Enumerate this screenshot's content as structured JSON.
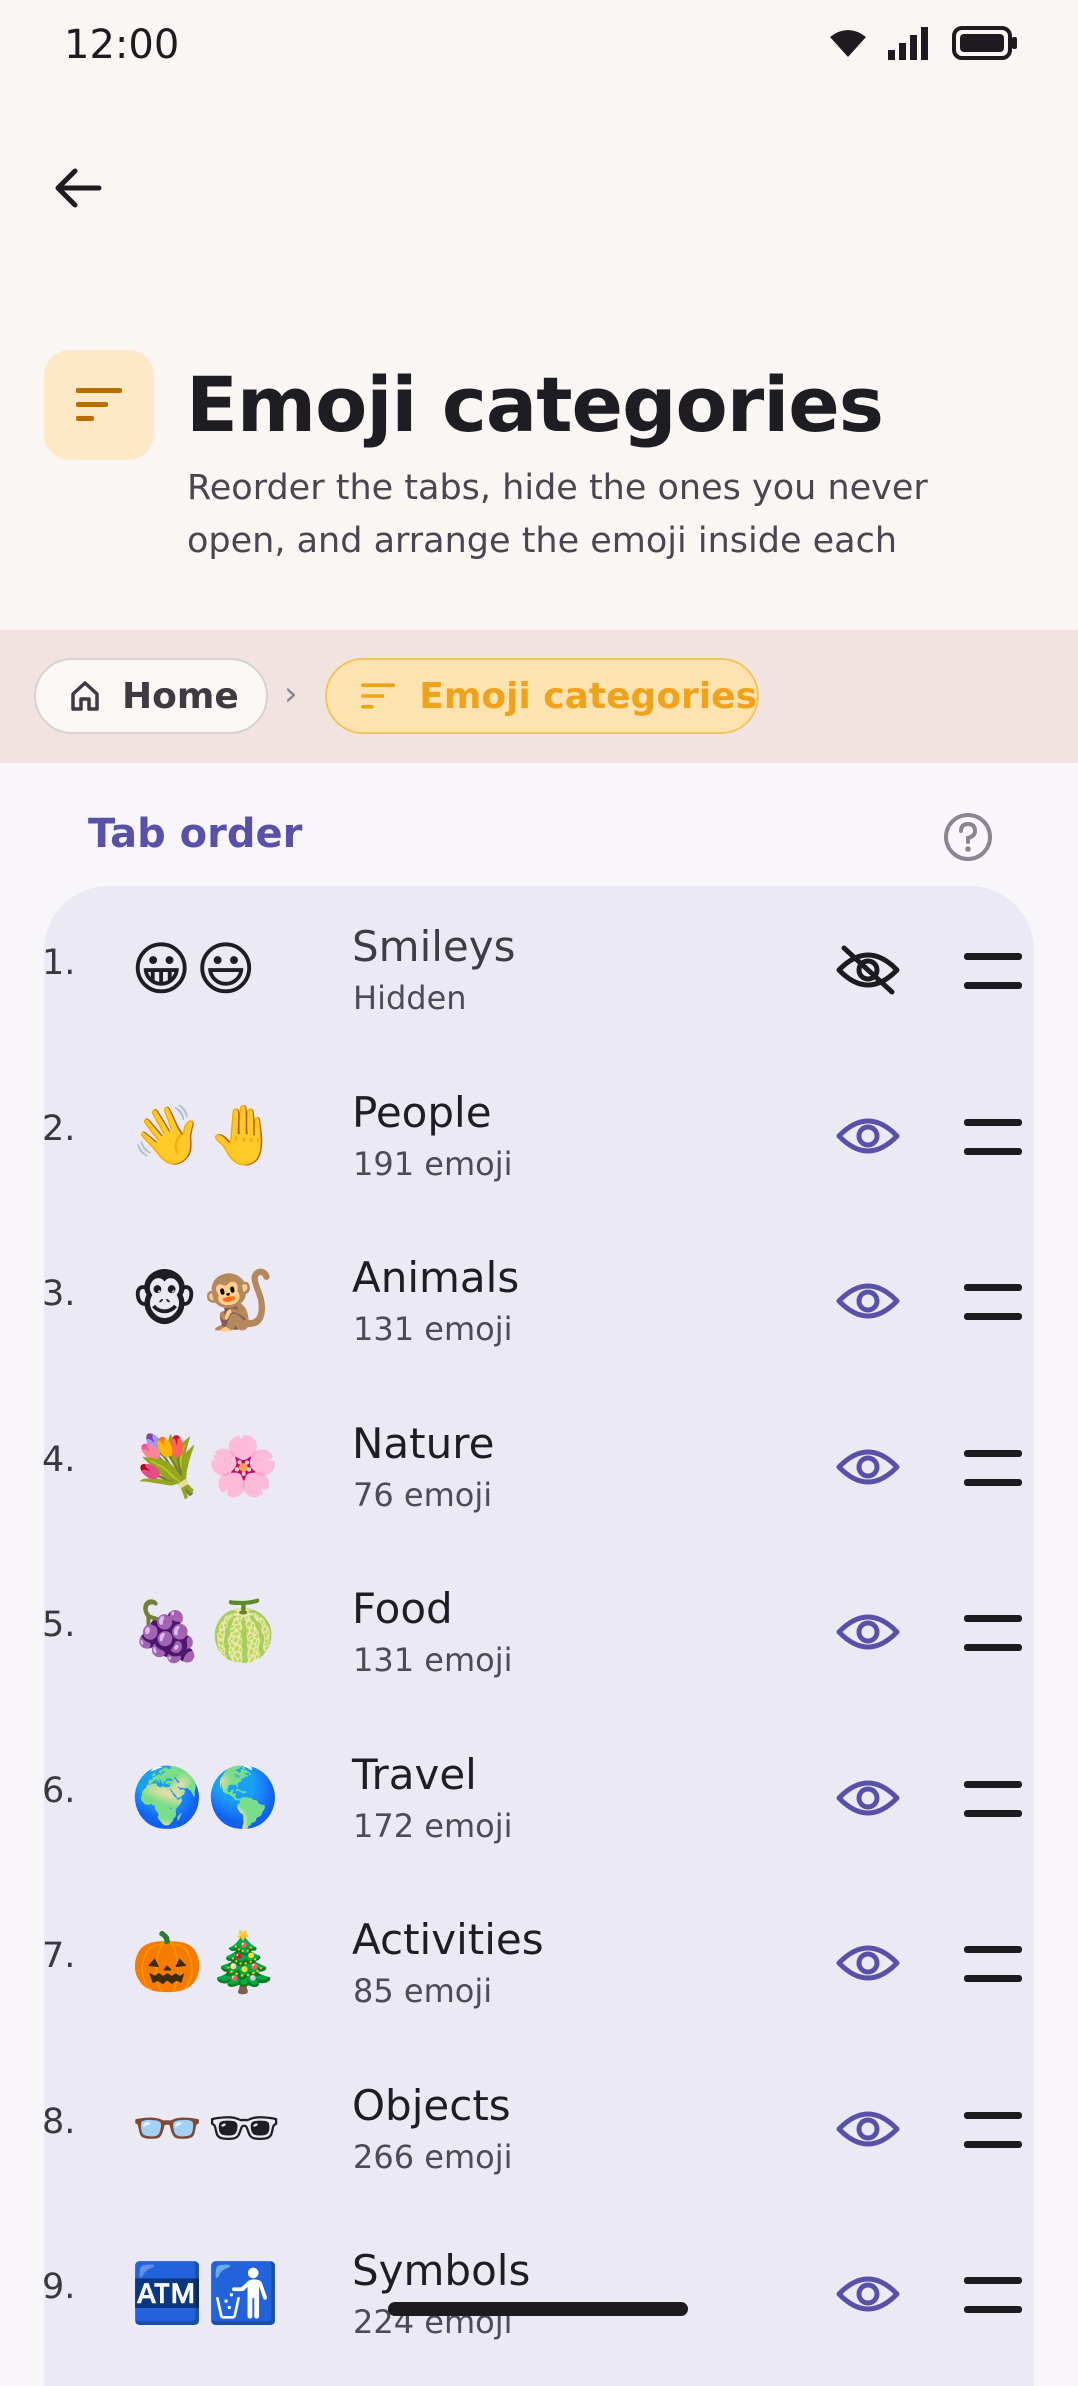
{
  "status_bar": {
    "time": "12:00"
  },
  "header": {
    "title": "Emoji categories",
    "subtitle": "Reorder the tabs, hide the ones you never open, and arrange the emoji inside each",
    "icon": "sort-lines-icon"
  },
  "breadcrumb": {
    "home_label": "Home",
    "current_label": "Emoji categories",
    "separator": "›"
  },
  "section": {
    "title": "Tab order"
  },
  "colors": {
    "accent": "#5951a9",
    "chip_current_text": "#f0a21a",
    "chip_current_bg": "#fde3b0",
    "card_bg": "#ebe9f4"
  },
  "categories": [
    {
      "num": "1.",
      "emoji": [
        "😀",
        "😃"
      ],
      "name": "Smileys",
      "subtitle": "Hidden",
      "visible": false
    },
    {
      "num": "2.",
      "emoji": [
        "👋",
        "🤚"
      ],
      "name": "People",
      "subtitle": "191 emoji",
      "visible": true
    },
    {
      "num": "3.",
      "emoji": [
        "🐵",
        "🐒"
      ],
      "name": "Animals",
      "subtitle": "131 emoji",
      "visible": true
    },
    {
      "num": "4.",
      "emoji": [
        "💐",
        "🌸"
      ],
      "name": "Nature",
      "subtitle": "76 emoji",
      "visible": true
    },
    {
      "num": "5.",
      "emoji": [
        "🍇",
        "🍈"
      ],
      "name": "Food",
      "subtitle": "131 emoji",
      "visible": true
    },
    {
      "num": "6.",
      "emoji": [
        "🌍",
        "🌎"
      ],
      "name": "Travel",
      "subtitle": "172 emoji",
      "visible": true
    },
    {
      "num": "7.",
      "emoji": [
        "🎃",
        "🎄"
      ],
      "name": "Activities",
      "subtitle": "85 emoji",
      "visible": true
    },
    {
      "num": "8.",
      "emoji": [
        "👓",
        "🕶"
      ],
      "name": "Objects",
      "subtitle": "266 emoji",
      "visible": true
    },
    {
      "num": "9.",
      "emoji": [
        "🏧",
        "🚮"
      ],
      "name": "Symbols",
      "subtitle": "224 emoji",
      "visible": true
    }
  ]
}
